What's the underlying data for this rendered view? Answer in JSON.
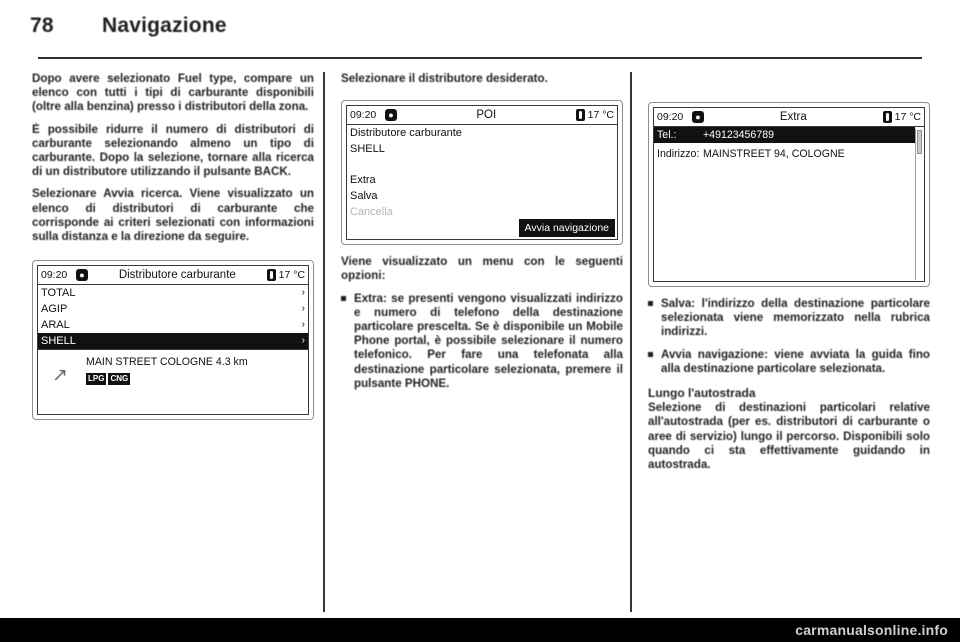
{
  "page": {
    "number": "78",
    "title": "Navigazione",
    "watermark": "carmanualsonline.info"
  },
  "col1": {
    "p1": "Dopo avere selezionato Fuel type, compare un elenco con tutti i tipi di carburante disponibili (oltre alla benzina) presso i distributori della zona.",
    "p2": "È possibile ridurre il numero di distributori di carburante selezionando almeno un tipo di carburante. Dopo la selezione, tornare alla ricerca di un distributore utilizzando il pulsante BACK.",
    "p3": "Selezionare Avvia ricerca. Viene visualizzato un elenco di distributori di carburante che corrisponde ai criteri selezionati con informazioni sulla distanza e la direzione da seguire."
  },
  "screen1": {
    "time": "09:20",
    "disc_icon": "disc-icon",
    "title": "Distributore carburante",
    "thermo_icon": "thermometer-icon",
    "temp": "17 °C",
    "rows": [
      {
        "label": "TOTAL",
        "selected": false
      },
      {
        "label": "AGIP",
        "selected": false
      },
      {
        "label": "ARAL",
        "selected": false
      },
      {
        "label": "SHELL",
        "selected": true
      }
    ],
    "chevron": "›",
    "detail": {
      "arrow_icon": "direction-arrow-icon",
      "address": "MAIN STREET  COLOGNE 4.3  km",
      "tags": [
        "LPG",
        "CNG"
      ]
    }
  },
  "col2": {
    "intro": "Selezionare il distributore desiderato.",
    "after": "Viene visualizzato un menu con le seguenti opzioni:",
    "bullet1": "Extra: se presenti vengono visualizzati indirizzo e numero di telefono della destinazione particolare prescelta. Se è disponibile un Mobile Phone portal, è possibile selezionare il numero telefonico. Per fare una telefonata alla destinazione particolare selezionata, premere il pulsante PHONE."
  },
  "screen2": {
    "time": "09:20",
    "disc_icon": "disc-icon",
    "title": "POI",
    "thermo_icon": "thermometer-icon",
    "temp": "17 °C",
    "rows": [
      {
        "label": "Distributore carburante",
        "state": "normal"
      },
      {
        "label": "SHELL",
        "state": "normal"
      },
      {
        "label": "",
        "state": "blank"
      },
      {
        "label": "Extra",
        "state": "normal"
      },
      {
        "label": "Salva",
        "state": "normal"
      },
      {
        "label": "Cancella",
        "state": "dim"
      }
    ],
    "action_button": "Avvia navigazione"
  },
  "screen3": {
    "time": "09:20",
    "disc_icon": "disc-icon",
    "title": "Extra",
    "thermo_icon": "thermometer-icon",
    "temp": "17 °C",
    "entries": [
      {
        "key": "Tel.:",
        "value": "+49123456789",
        "selected": true
      },
      {
        "key": "Indirizzo:",
        "value": "MAINSTREET 94, COLOGNE",
        "selected": false
      }
    ]
  },
  "col3": {
    "bullet1": "Salva: l'indirizzo della destinazione particolare selezionata viene memorizzato nella rubrica indirizzi.",
    "bullet2": "Avvia navigazione: viene avviata la guida fino alla destinazione particolare selezionata.",
    "heading": "Lungo l'autostrada",
    "p1": "Selezione di destinazioni particolari relative all'autostrada (per es. distributori di carburante o aree di servizio) lungo il percorso. Disponibili solo quando ci sta effettivamente guidando in autostrada."
  }
}
